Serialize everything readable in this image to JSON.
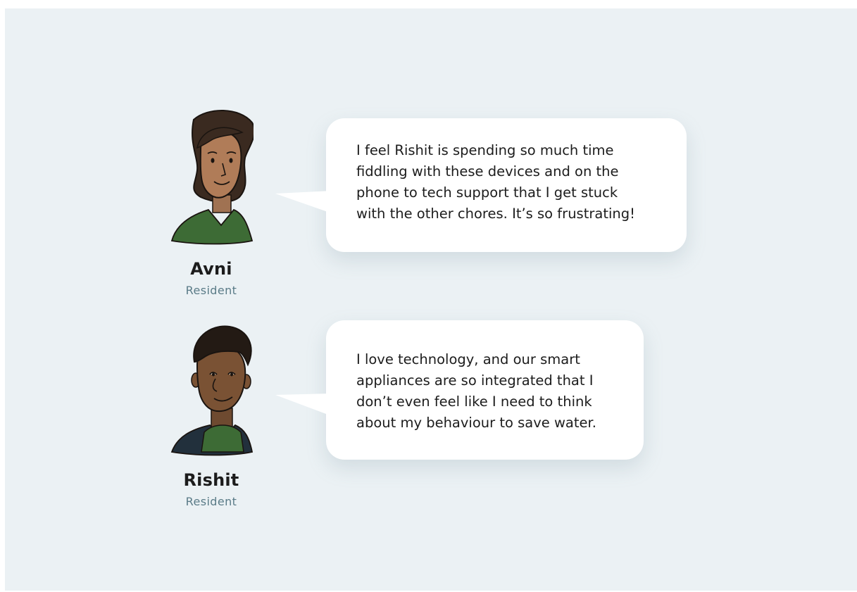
{
  "personas": [
    {
      "name": "Avni",
      "role": "Resident",
      "avatar_icon": "woman-avatar-icon",
      "quote": "I feel Rishit is spending so much time\nfiddling with these devices and on the\nphone to tech support that I get stuck\nwith the other chores. It’s so frustrating!"
    },
    {
      "name": "Rishit",
      "role": "Resident",
      "avatar_icon": "man-avatar-icon",
      "quote": "I love technology, and our smart\nappliances are so integrated that I\ndon’t even feel like I need to think\nabout my behaviour to save water."
    }
  ],
  "colors": {
    "background": "#ebf1f4",
    "bubble": "#ffffff",
    "name": "#1c1c1c",
    "role": "#5a7b87",
    "shirt": "#3d6b35"
  }
}
